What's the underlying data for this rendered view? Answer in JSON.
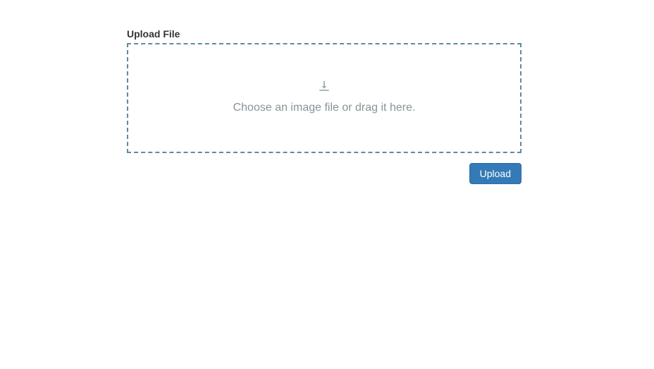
{
  "form": {
    "label": "Upload File",
    "dropzone_text": "Choose an image file or drag it here.",
    "upload_button_label": "Upload"
  }
}
